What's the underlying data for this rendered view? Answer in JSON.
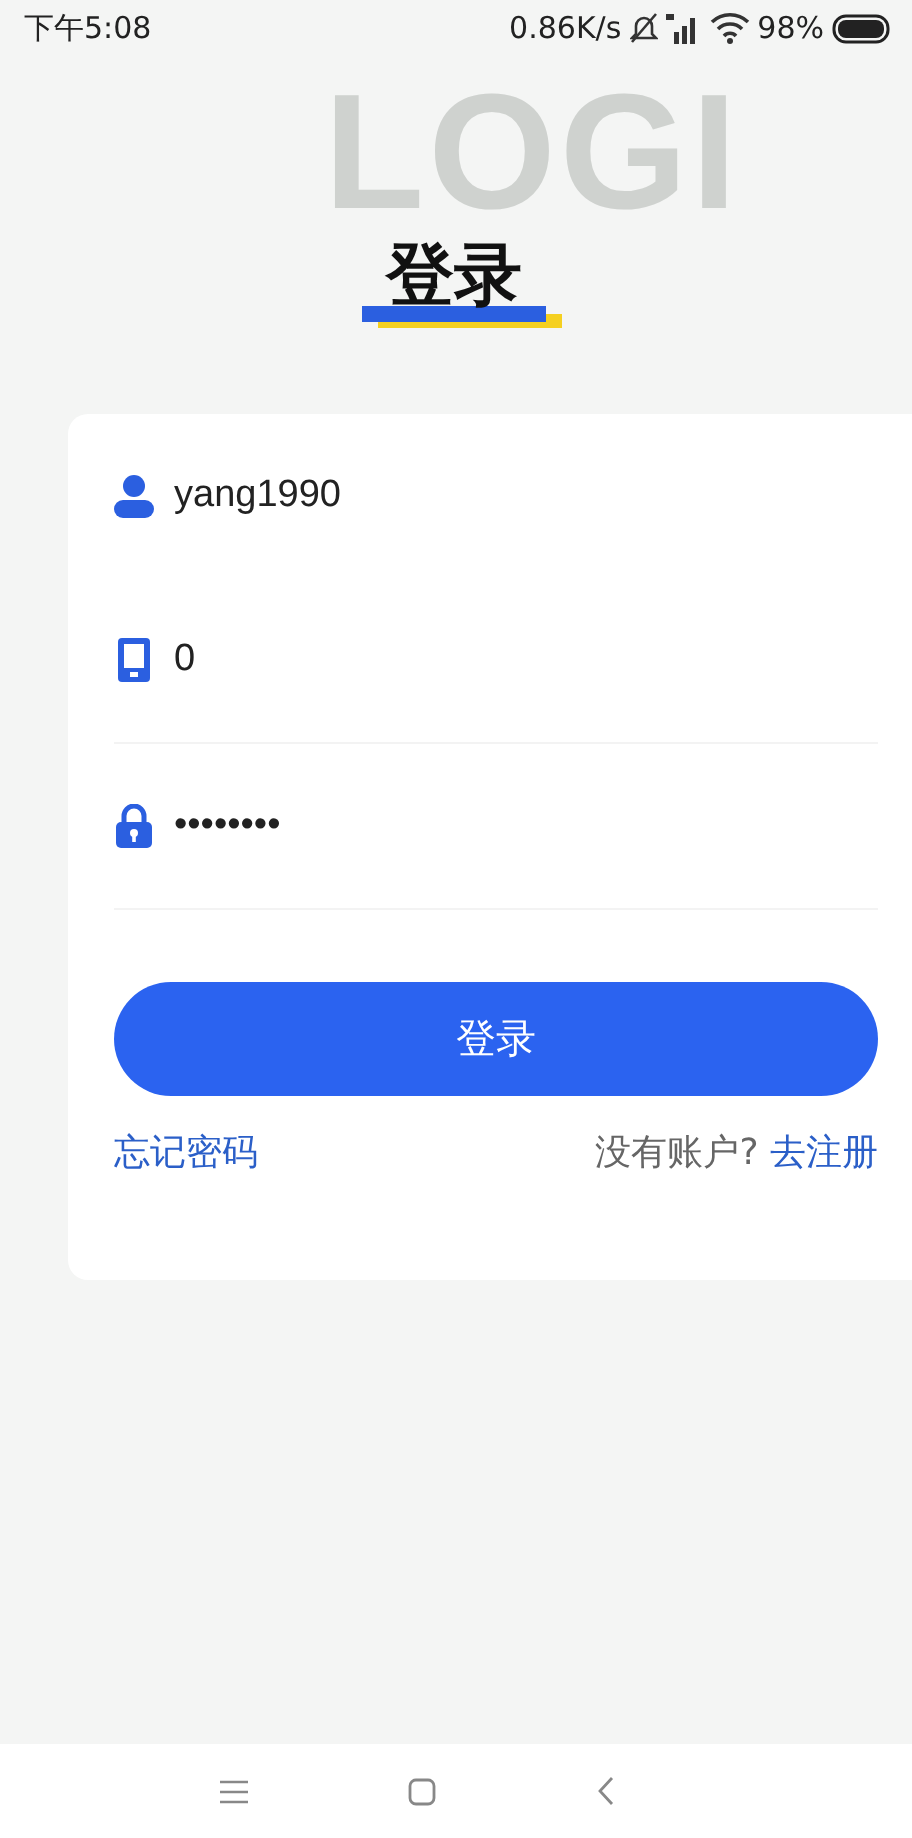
{
  "status_bar": {
    "time": "下午5:08",
    "network_speed": "0.86K/s",
    "battery": "98%"
  },
  "header": {
    "backdrop_text": "LOGI",
    "title": "登录"
  },
  "form": {
    "fields": [
      {
        "kind": "user",
        "value": "yang1990"
      },
      {
        "kind": "phone",
        "value": "0"
      },
      {
        "kind": "password",
        "value": "••••••••"
      }
    ],
    "submit": "登录",
    "forgot_link": "忘记密码",
    "register_prompt": "没有账户?",
    "register_link": "去注册"
  }
}
